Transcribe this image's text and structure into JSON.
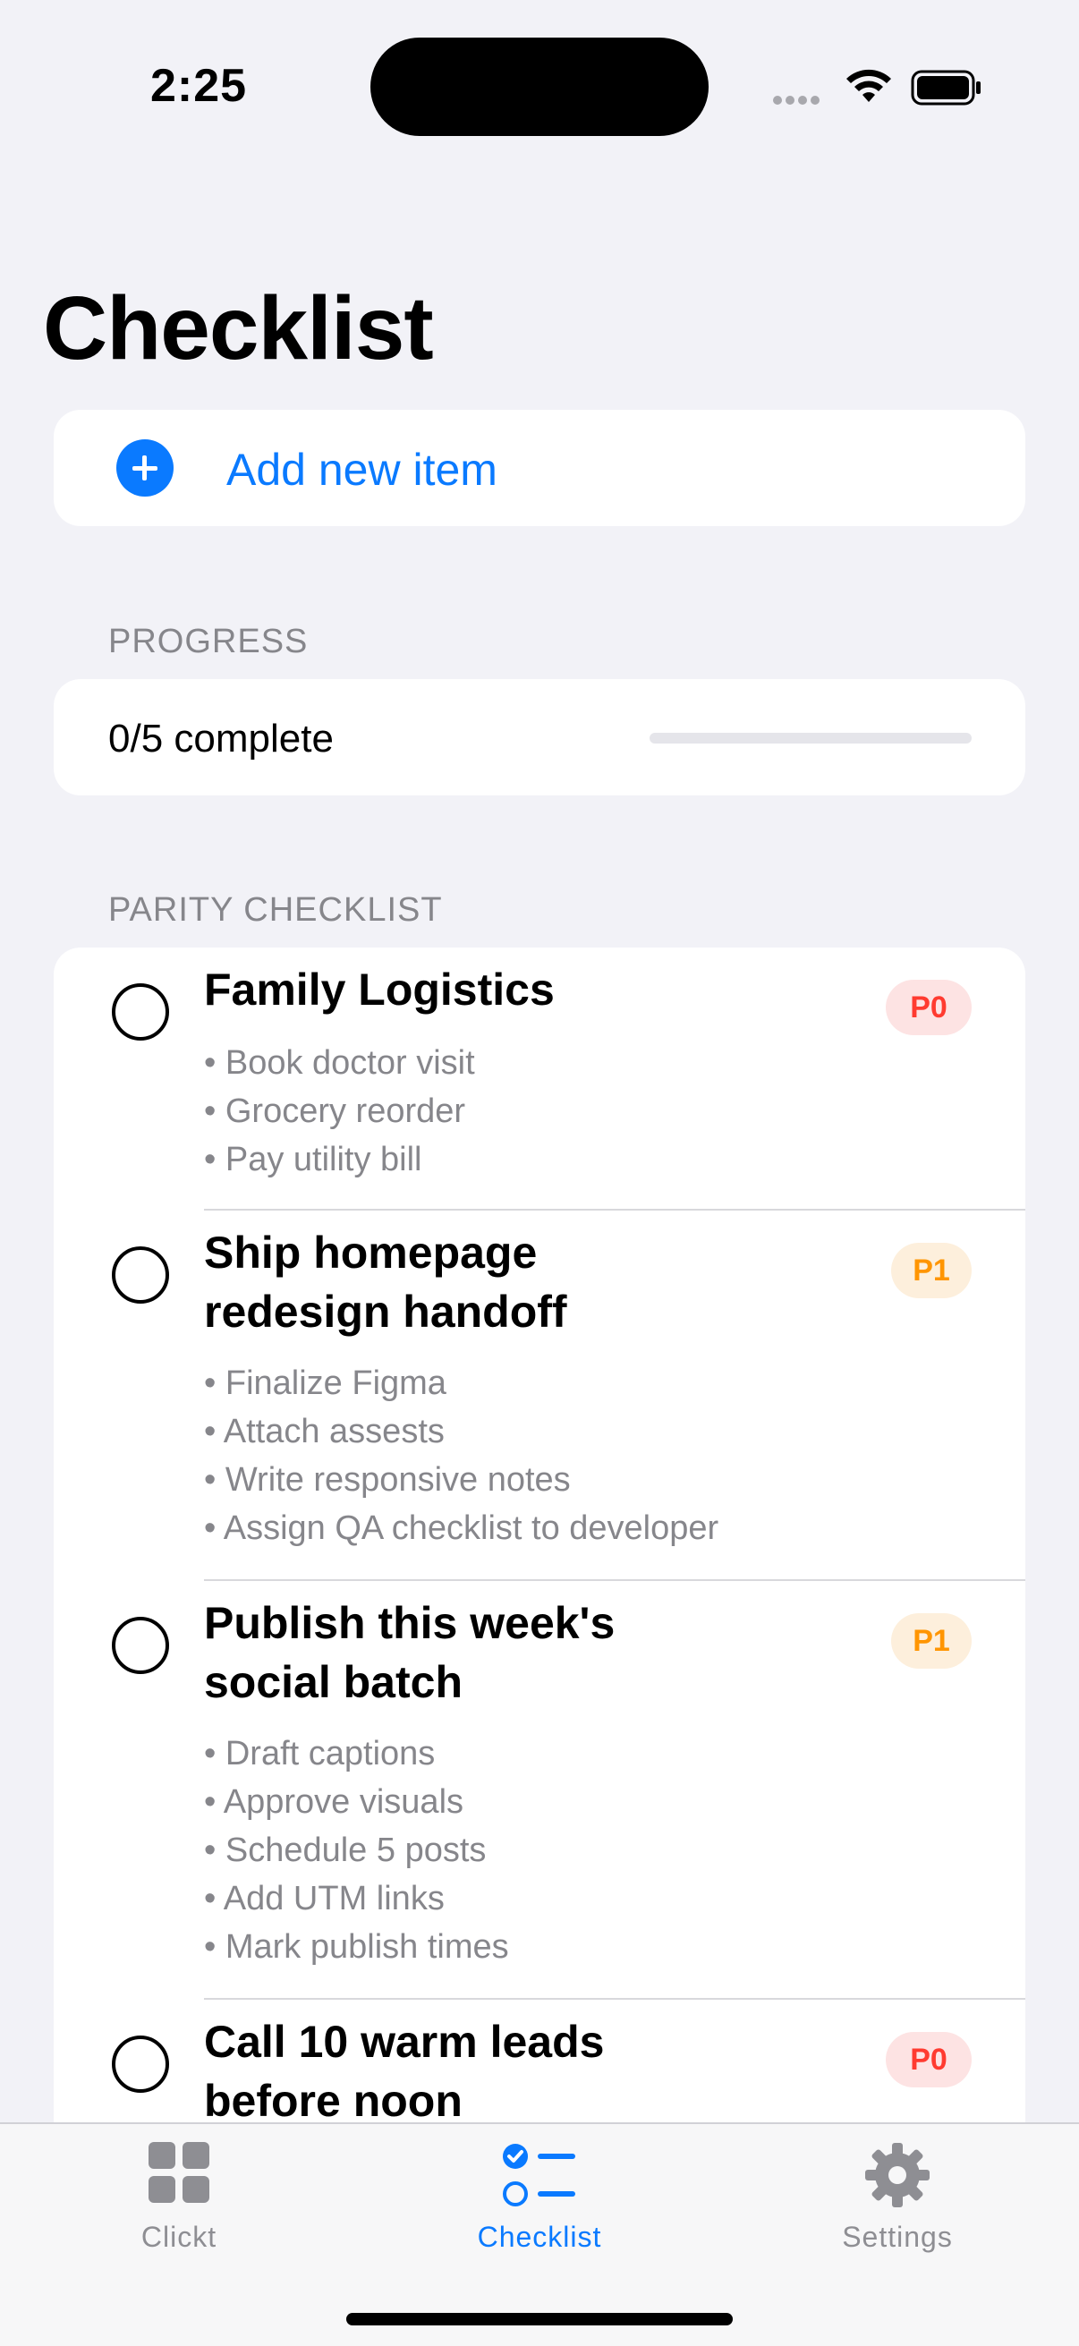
{
  "status_bar": {
    "time": "2:25"
  },
  "header": {
    "title": "Checklist"
  },
  "add_item": {
    "label": "Add new item"
  },
  "progress": {
    "section_label": "PROGRESS",
    "status_text": "0/5 complete",
    "completed_fraction": 0
  },
  "checklist": {
    "section_label": "PARITY CHECKLIST",
    "items": [
      {
        "title": "Family Logistics",
        "priority": "P0",
        "subtasks": [
          "• Book doctor visit",
          "• Grocery reorder",
          "• Pay utility bill"
        ]
      },
      {
        "title": "Ship homepage redesign handoff",
        "priority": "P1",
        "subtasks": [
          "• Finalize Figma",
          "• Attach assests",
          "• Write responsive notes",
          "• Assign QA checklist to developer"
        ]
      },
      {
        "title": "Publish this week's social batch",
        "priority": "P1",
        "subtasks": [
          "• Draft captions",
          "• Approve visuals",
          "• Schedule 5 posts",
          "• Add UTM links",
          "• Mark publish times"
        ]
      },
      {
        "title": "Call 10 warm leads before noon",
        "priority": "P0",
        "subtasks": []
      }
    ]
  },
  "tab_bar": {
    "tabs": [
      {
        "label": "Clickt",
        "icon": "grid-icon",
        "active": false
      },
      {
        "label": "Checklist",
        "icon": "checklist-icon",
        "active": true
      },
      {
        "label": "Settings",
        "icon": "gear-icon",
        "active": false
      }
    ]
  },
  "colors": {
    "accent": "#0a7aff",
    "p0": "#ff3b30",
    "p1": "#ff9500",
    "background": "#f2f2f7"
  }
}
